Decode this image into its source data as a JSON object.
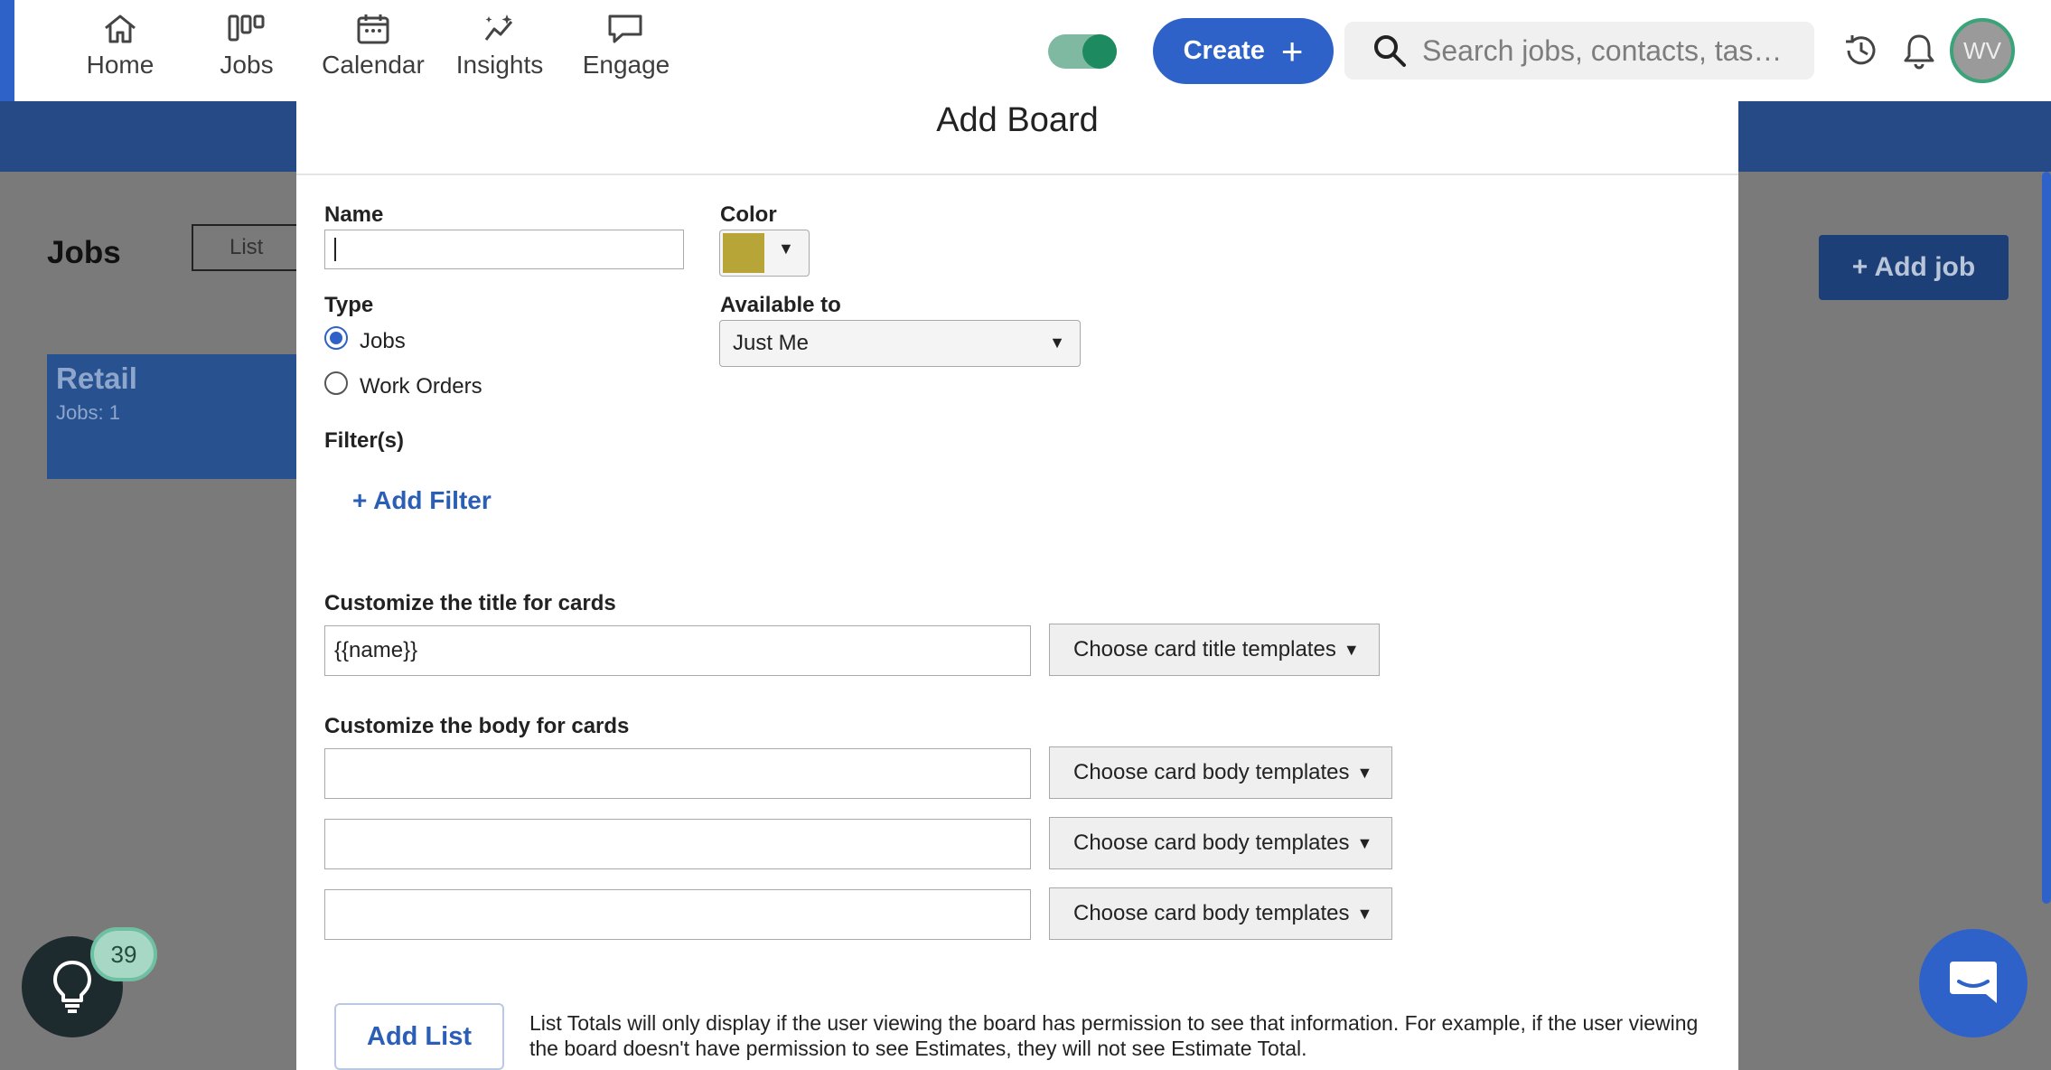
{
  "nav": {
    "items": [
      {
        "label": "Home",
        "icon": "home-icon"
      },
      {
        "label": "Jobs",
        "icon": "jobs-board-icon"
      },
      {
        "label": "Calendar",
        "icon": "calendar-icon"
      },
      {
        "label": "Insights",
        "icon": "insights-icon"
      },
      {
        "label": "Engage",
        "icon": "chat-bubble-icon"
      }
    ],
    "create_label": "Create",
    "search_placeholder": "Search jobs, contacts, tas…",
    "avatar_initials": "WV",
    "toggle_on": true
  },
  "background": {
    "page_title": "Jobs",
    "list_button": "List",
    "board_card": {
      "title": "Retail",
      "subtitle": "Jobs: 1"
    },
    "add_job_label": "+ Add job"
  },
  "modal": {
    "title": "Add Board",
    "name_label": "Name",
    "name_value": "",
    "color_label": "Color",
    "color_value": "#b7a637",
    "type_label": "Type",
    "type_options": [
      {
        "label": "Jobs",
        "checked": true
      },
      {
        "label": "Work Orders",
        "checked": false
      }
    ],
    "available_label": "Available to",
    "available_value": "Just Me",
    "filters_label": "Filter(s)",
    "add_filter_label": "+ Add Filter",
    "card_title_label": "Customize the title for cards",
    "card_title_value": "{{name}}",
    "card_title_template_btn": "Choose card title templates",
    "card_body_label": "Customize the body for cards",
    "card_body_rows": [
      {
        "value": "",
        "template_btn": "Choose card body templates"
      },
      {
        "value": "",
        "template_btn": "Choose card body templates"
      },
      {
        "value": "",
        "template_btn": "Choose card body templates"
      }
    ],
    "add_list_label": "Add List",
    "totals_note": "List Totals will only display if the user viewing the board has permission to see that information. For example, if the user viewing the board doesn't have permission to see Estimates, they will not see Estimate Total."
  },
  "widgets": {
    "tips_count": "39"
  }
}
